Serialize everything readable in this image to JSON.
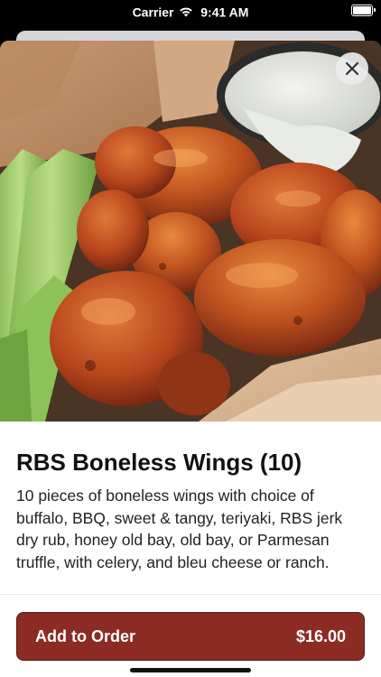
{
  "status_bar": {
    "carrier": "Carrier",
    "time": "9:41 AM",
    "battery_level": 1.0
  },
  "item": {
    "title": "RBS Boneless Wings (10)",
    "description": "10 pieces of boneless wings with choice of buffalo, BBQ, sweet & tangy, teriyaki, RBS jerk dry rub, honey old bay, old bay, or Parmesan truffle, with celery, and bleu cheese or ranch."
  },
  "add_button": {
    "label": "Add to Order",
    "price": "$16.00"
  },
  "icons": {
    "close": "close-icon",
    "wifi": "wifi-icon",
    "battery": "battery-icon"
  },
  "colors": {
    "accent": "#8b2b23",
    "text": "#111111",
    "sheet": "#ffffff"
  }
}
